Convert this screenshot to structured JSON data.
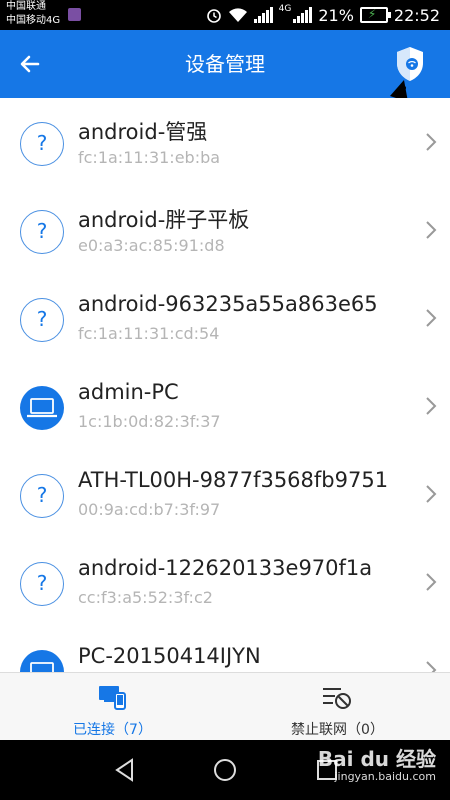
{
  "status_bar": {
    "carrier_1": "中国联通",
    "carrier_2": "中国移动4G",
    "network_4g": "4G",
    "battery": "21%",
    "time": "22:52"
  },
  "header": {
    "title": "设备管理",
    "back_icon": "arrow-left",
    "action_icon": "shield-wifi"
  },
  "devices": [
    {
      "name": "android-管强",
      "mac": "fc:1a:11:31:eb:ba",
      "type": "unknown",
      "icon_text": "?"
    },
    {
      "name": "android-胖子平板",
      "mac": "e0:a3:ac:85:91:d8",
      "type": "unknown",
      "icon_text": "?"
    },
    {
      "name": "android-963235a55a863e65",
      "mac": "fc:1a:11:31:cd:54",
      "type": "unknown",
      "icon_text": "?"
    },
    {
      "name": "admin-PC",
      "mac": "1c:1b:0d:82:3f:37",
      "type": "pc",
      "icon_text": ""
    },
    {
      "name": "ATH-TL00H-9877f3568fb9751",
      "mac": "00:9a:cd:b7:3f:97",
      "type": "unknown",
      "icon_text": "?"
    },
    {
      "name": "android-122620133e970f1a",
      "mac": "cc:f3:a5:52:3f:c2",
      "type": "unknown",
      "icon_text": "?"
    },
    {
      "name": "PC-20150414IJYN",
      "mac": "",
      "type": "pc",
      "icon_text": ""
    }
  ],
  "tabs": {
    "connected": "已连接（7）",
    "blocked": "禁止联网（0）",
    "active_color": "#1677e6",
    "inactive_color": "#333333"
  },
  "watermark": {
    "line1": "Bai du 经验",
    "line2": "jingyan.baidu.com"
  }
}
